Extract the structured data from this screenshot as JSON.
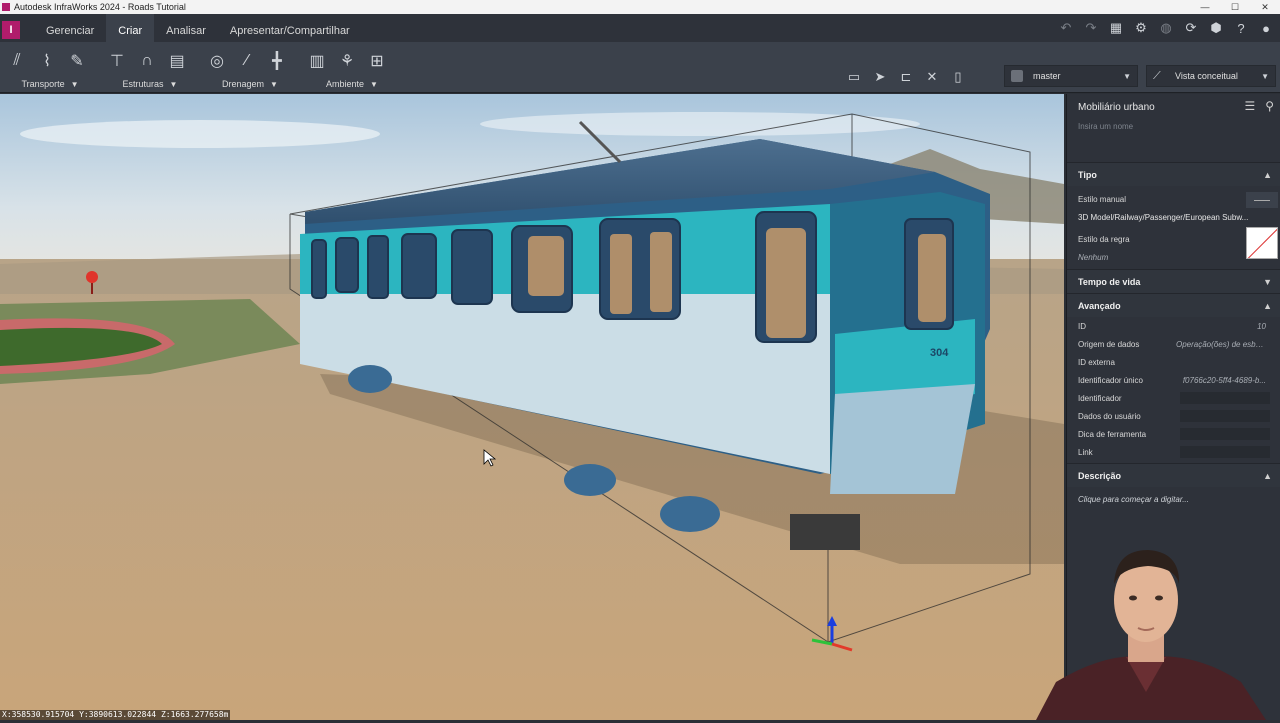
{
  "window": {
    "title": "Autodesk InfraWorks 2024 - Roads Tutorial",
    "controls": [
      "—",
      "☐",
      "✕"
    ]
  },
  "app": {
    "logo": "I"
  },
  "tabs": [
    {
      "label": "Gerenciar",
      "active": false
    },
    {
      "label": "Criar",
      "active": true
    },
    {
      "label": "Analisar",
      "active": false
    },
    {
      "label": "Apresentar/Compartilhar",
      "active": false
    }
  ],
  "ribbon": {
    "groups": [
      {
        "label": "Transporte",
        "icons": [
          "road-icon",
          "curve-road-icon",
          "pin-icon"
        ]
      },
      {
        "label": "Estruturas",
        "icons": [
          "bridge-icon",
          "tunnel-icon",
          "building-icon"
        ]
      },
      {
        "label": "Drenagem",
        "icons": [
          "culvert-icon",
          "pipe-icon",
          "inlet-icon"
        ]
      },
      {
        "label": "Ambiente",
        "icons": [
          "traffic-light-icon",
          "tree-icon",
          "furniture-icon"
        ]
      }
    ],
    "proposal": "master",
    "view_style": "Vista conceitual"
  },
  "viewport": {
    "coords": "X:358530.915704 Y:3890613.022844 Z:1663.277658m",
    "train_number": "304"
  },
  "panel": {
    "title": "Mobiliário urbano",
    "name_placeholder": "Insira um nome",
    "sections": {
      "tipo": "Tipo",
      "tempo": "Tempo de vida",
      "avancado": "Avançado",
      "descricao": "Descrição"
    },
    "tipo": {
      "estilo_manual_label": "Estilo manual",
      "estilo_manual_value": "3D Model/Railway/Passenger/European Subw...",
      "estilo_regra_label": "Estilo da regra",
      "estilo_regra_value": "Nenhum"
    },
    "avancado": {
      "id_label": "ID",
      "id_value": "10",
      "origem_label": "Origem de dados",
      "origem_value": "Operação(ões) de esbo...",
      "idext_label": "ID externa",
      "ident_unico_label": "Identificador único",
      "ident_unico_value": "f0766c20-5ff4-4689-b...",
      "ident_label": "Identificador",
      "dados_label": "Dados do usuário",
      "dica_label": "Dica de ferramenta",
      "link_label": "Link"
    },
    "descricao_placeholder": "Clique para começar a digitar..."
  }
}
